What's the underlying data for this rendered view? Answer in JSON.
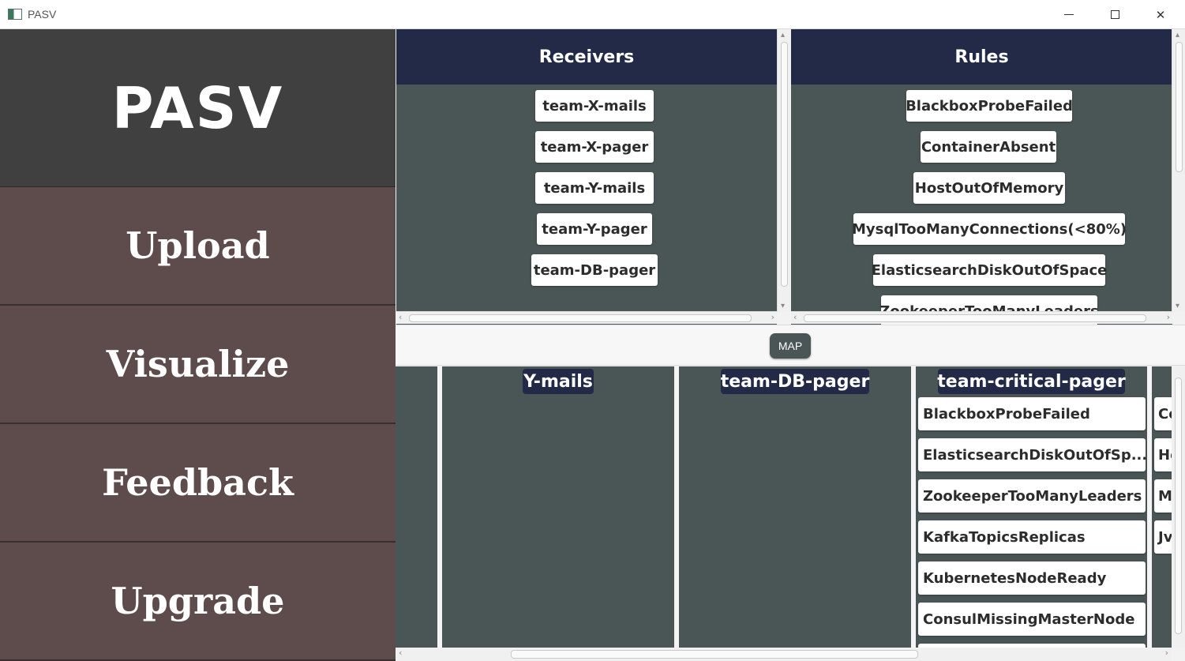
{
  "window": {
    "title": "PASV",
    "minimize_icon": "minimize-icon",
    "maximize_icon": "maximize-icon",
    "close_icon": "close-icon",
    "close_glyph": "✕"
  },
  "sidebar": {
    "logo": "PASV",
    "items": [
      {
        "label": "Upload"
      },
      {
        "label": "Visualize"
      },
      {
        "label": "Feedback"
      },
      {
        "label": "Upgrade"
      }
    ]
  },
  "receivers": {
    "title": "Receivers",
    "items": [
      "team-X-mails",
      "team-X-pager",
      "team-Y-mails",
      "team-Y-pager",
      "team-DB-pager"
    ]
  },
  "rules": {
    "title": "Rules",
    "items": [
      "BlackboxProbeFailed",
      "ContainerAbsent",
      "HostOutOfMemory",
      "MysqlTooManyConnections(<80%)",
      "ElasticsearchDiskOutOfSpace",
      "ZookeeperTooManyLeaders"
    ]
  },
  "map_button": {
    "label": "MAP"
  },
  "board": {
    "columns": [
      {
        "title": "Y-mails",
        "items": []
      },
      {
        "title": "team-DB-pager",
        "items": []
      },
      {
        "title": "team-critical-pager",
        "items": [
          "BlackboxProbeFailed",
          "ElasticsearchDiskOutOfSp...",
          "ZookeeperTooManyLeaders",
          "KafkaTopicsReplicas",
          "KubernetesNodeReady",
          "ConsulMissingMasterNode"
        ]
      },
      {
        "title": "",
        "items": [
          "Co",
          "Ho",
          "M",
          "Jv"
        ]
      }
    ]
  },
  "colors": {
    "sidebar_bg": "#5e4b4b",
    "logo_bg": "#404040",
    "header_bg": "#222a47",
    "panel_bg": "#4a5556"
  }
}
